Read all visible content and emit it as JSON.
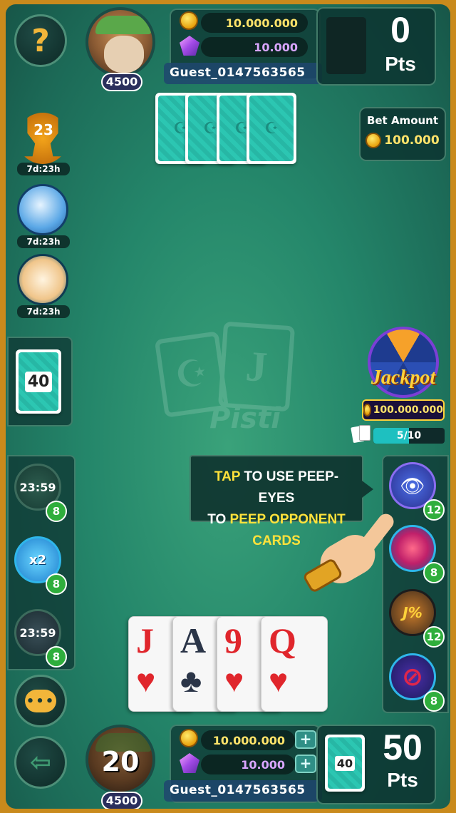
{
  "opponent": {
    "level": "4500",
    "coins": "10.000.000",
    "gems": "10.000",
    "name": "Guest_0147563565",
    "points": "0",
    "points_label": "Pts"
  },
  "help_icon": "?",
  "bet": {
    "label": "Bet Amount",
    "amount": "100.000"
  },
  "events": [
    {
      "name": "trophy-event",
      "value": "23",
      "timer": "7d:23h"
    },
    {
      "name": "shark-event",
      "timer": "7d:23h"
    },
    {
      "name": "calendar-event",
      "timer": "7d:23h"
    }
  ],
  "deck_count": "40",
  "logo": {
    "card_letter": "J",
    "text": "Pisti"
  },
  "jackpot": {
    "title": "Jackpot",
    "amount": "100.000.000",
    "progress": "5/10",
    "progress_fraction": 0.5
  },
  "left_boosters": [
    {
      "name": "refresh-booster",
      "timer": "23:59",
      "count": "8"
    },
    {
      "name": "star-x2-booster",
      "label": "x2",
      "count": "8"
    },
    {
      "name": "coin-booster",
      "timer": "23:59",
      "count": "8"
    }
  ],
  "right_boosters": [
    {
      "name": "peep-eye-booster",
      "count": "12"
    },
    {
      "name": "swap-cards-booster",
      "count": "8"
    },
    {
      "name": "jackpot-percent-booster",
      "label": "J%",
      "count": "12"
    },
    {
      "name": "no-bet-booster",
      "count": "8"
    }
  ],
  "tooltip": {
    "line1_highlight": "TAP",
    "line1_rest": " TO USE PEEP-EYES",
    "line2_prefix": "TO ",
    "line2_highlight": "PEEP OPPONENT CARDS"
  },
  "hand": [
    {
      "rank": "J",
      "suit": "♥",
      "color": "red"
    },
    {
      "rank": "A",
      "suit": "♣",
      "color": "black"
    },
    {
      "rank": "9",
      "suit": "♥",
      "color": "red"
    },
    {
      "rank": "Q",
      "suit": "♥",
      "color": "red"
    }
  ],
  "player": {
    "level": "4500",
    "avatar_number": "20",
    "coins": "10.000.000",
    "gems": "10.000",
    "name": "Guest_0147563565",
    "deck_count": "40",
    "points": "50",
    "points_label": "Pts"
  },
  "colors": {
    "felt": "#24866a",
    "frame": "#c98a1c",
    "highlight": "#ffe23b",
    "coin_text": "#ffe36a",
    "gem_text": "#d9a6ff"
  }
}
